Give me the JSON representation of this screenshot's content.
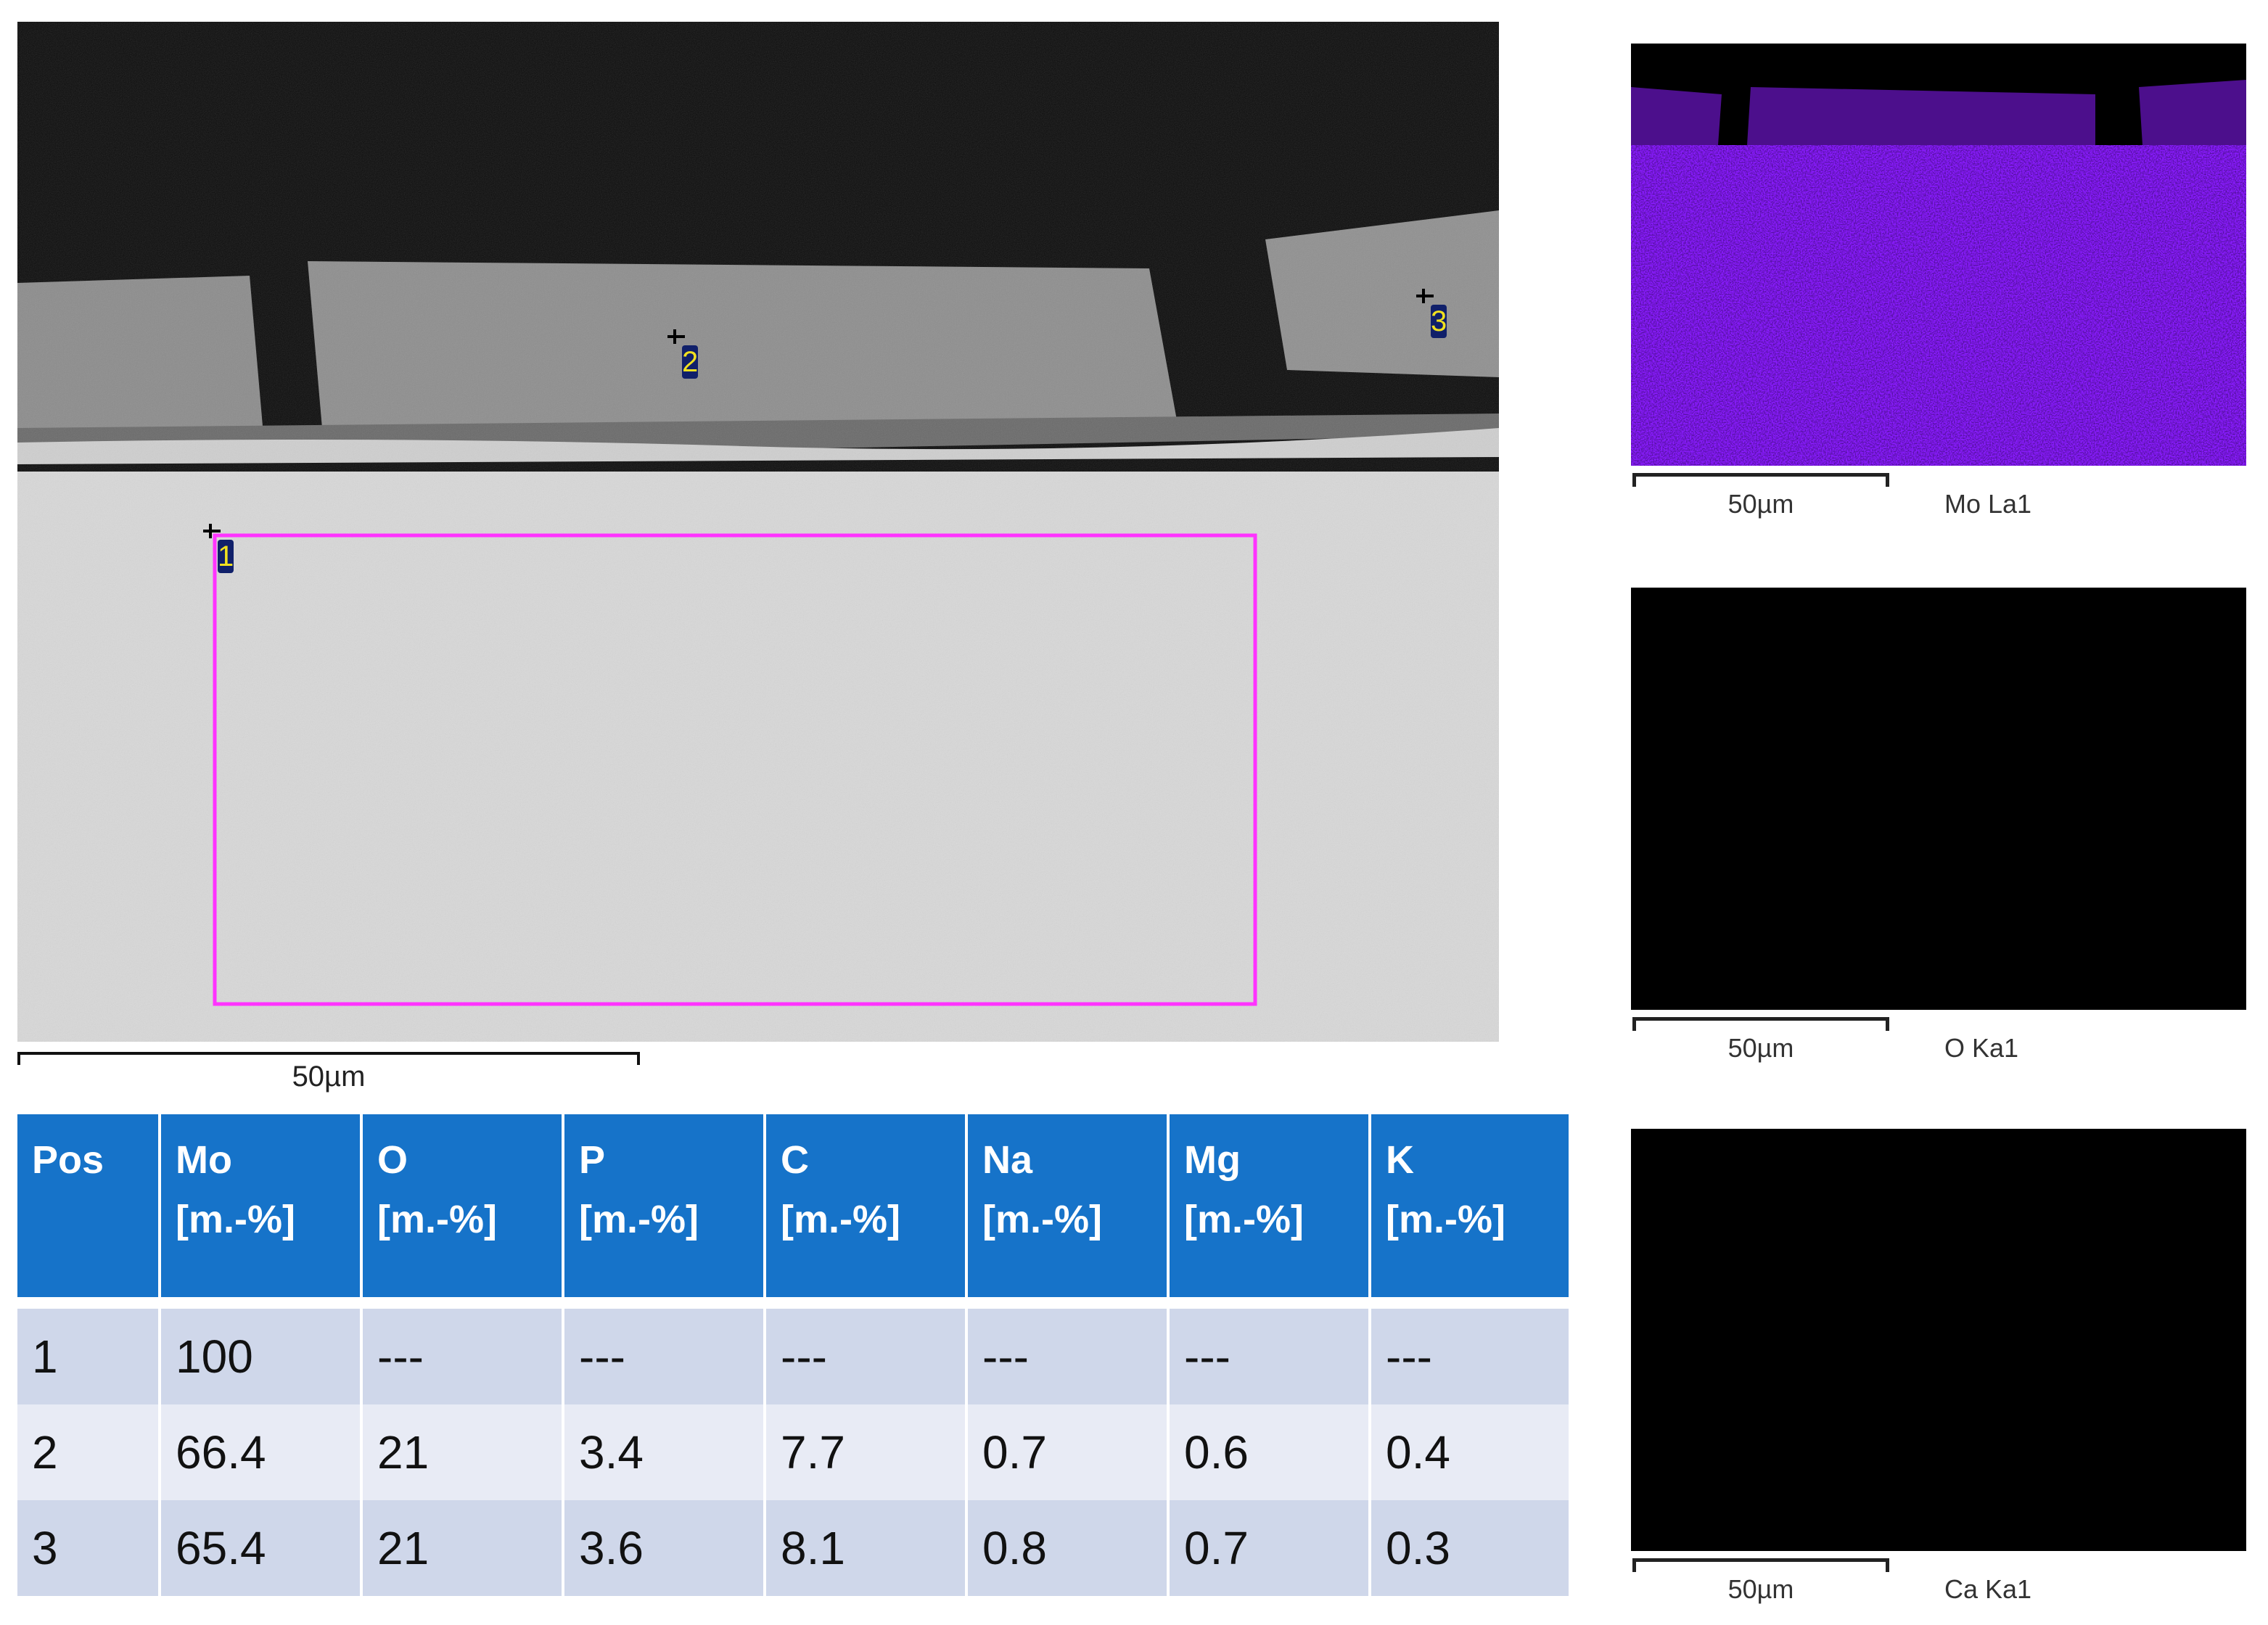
{
  "sem_image": {
    "markers": [
      "1",
      "2",
      "3"
    ],
    "scale_label": "50µm",
    "roi_color": "#ff33ff"
  },
  "table": {
    "headers": [
      {
        "name": "Pos",
        "unit": ""
      },
      {
        "name": "Mo",
        "unit": "[m.-%]"
      },
      {
        "name": "O",
        "unit": "[m.-%]"
      },
      {
        "name": "P",
        "unit": "[m.-%]"
      },
      {
        "name": "C",
        "unit": "[m.-%]"
      },
      {
        "name": "Na",
        "unit": "[m.-%]"
      },
      {
        "name": "Mg",
        "unit": "[m.-%]"
      },
      {
        "name": "K",
        "unit": "[m.-%]"
      }
    ],
    "rows": [
      [
        "1",
        "100",
        "---",
        "---",
        "---",
        "---",
        "---",
        "---"
      ],
      [
        "2",
        "66.4",
        "21",
        "3.4",
        "7.7",
        "0.7",
        "0.6",
        "0.4"
      ],
      [
        "3",
        "65.4",
        "21",
        "3.6",
        "8.1",
        "0.8",
        "0.7",
        "0.3"
      ]
    ],
    "header_color": "#1673c9"
  },
  "maps": [
    {
      "label": "Mo La1",
      "scale_label": "50µm",
      "color": "#8a1cff"
    },
    {
      "label": "O Ka1",
      "scale_label": "50µm",
      "color": "#c8c010"
    },
    {
      "label": "Ca Ka1",
      "scale_label": "50µm",
      "color": "#ff7a10"
    }
  ]
}
